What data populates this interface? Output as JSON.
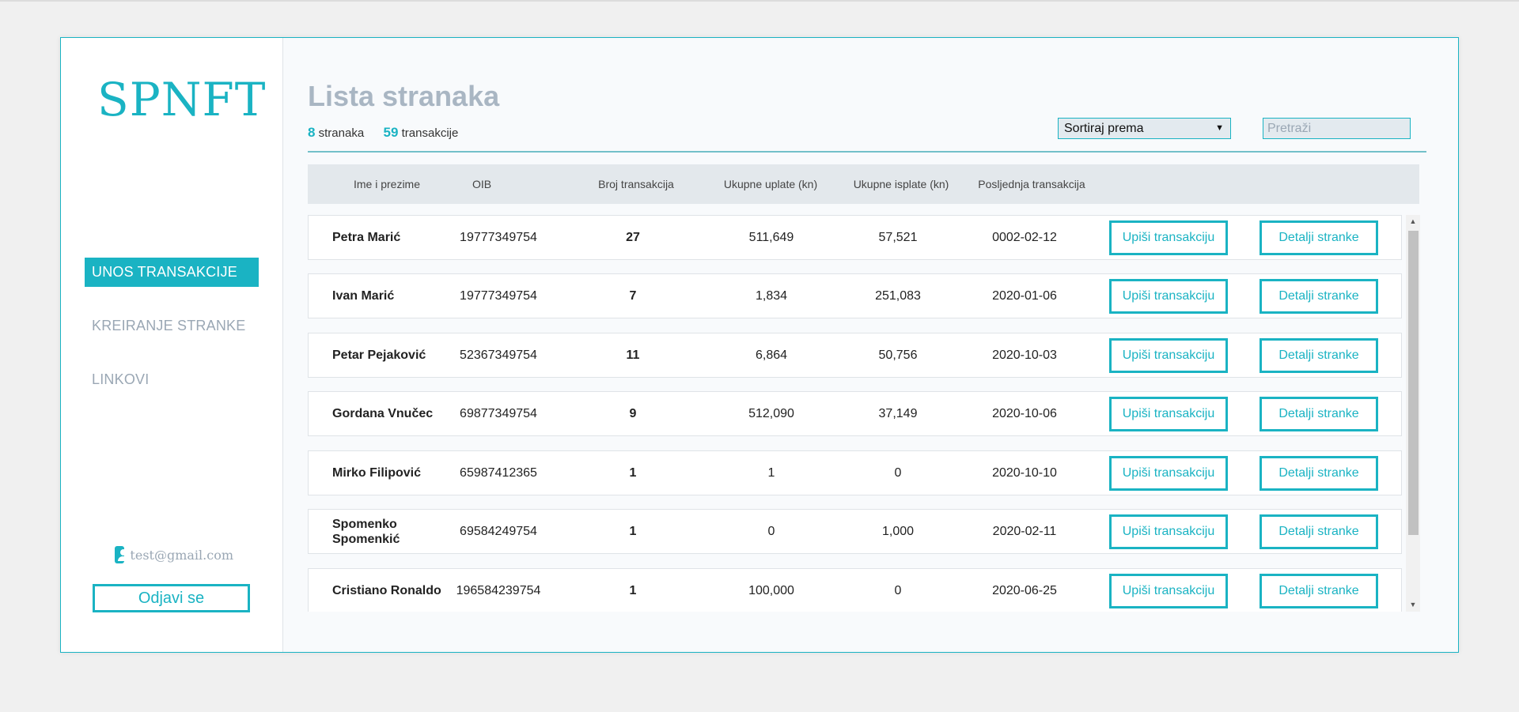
{
  "app": {
    "logo": "SPNFT"
  },
  "sidebar": {
    "nav": [
      {
        "label": "UNOS TRANSAKCIJE",
        "active": true
      },
      {
        "label": "KREIRANJE STRANKE",
        "active": false
      },
      {
        "label": "LINKOVI",
        "active": false
      }
    ],
    "user_email": "test@gmail.com",
    "logout_label": "Odjavi se"
  },
  "header": {
    "title": "Lista stranaka",
    "client_count": "8",
    "client_count_label": "stranaka",
    "transaction_count": "59",
    "transaction_count_label": "transakcije",
    "sort_label": "Sortiraj prema",
    "search_placeholder": "Pretraži"
  },
  "table": {
    "columns": [
      "Ime i prezime",
      "OIB",
      "Broj transakcija",
      "Ukupne uplate (kn)",
      "Ukupne isplate (kn)",
      "Posljednja transakcija"
    ],
    "action_add_label": "Upiši transakciju",
    "action_details_label": "Detalji stranke",
    "rows": [
      {
        "name": "Petra Marić",
        "oib": "19777349754",
        "count": "27",
        "deposits": "511,649",
        "withdrawals": "57,521",
        "last": "0002-02-12"
      },
      {
        "name": "Ivan Marić",
        "oib": "19777349754",
        "count": "7",
        "deposits": "1,834",
        "withdrawals": "251,083",
        "last": "2020-01-06"
      },
      {
        "name": "Petar Pejaković",
        "oib": "52367349754",
        "count": "11",
        "deposits": "6,864",
        "withdrawals": "50,756",
        "last": "2020-10-03"
      },
      {
        "name": "Gordana Vnučec",
        "oib": "69877349754",
        "count": "9",
        "deposits": "512,090",
        "withdrawals": "37,149",
        "last": "2020-10-06"
      },
      {
        "name": "Mirko Filipović",
        "oib": "65987412365",
        "count": "1",
        "deposits": "1",
        "withdrawals": "0",
        "last": "2020-10-10"
      },
      {
        "name": "Spomenko Spomenkić",
        "oib": "69584249754",
        "count": "1",
        "deposits": "0",
        "withdrawals": "1,000",
        "last": "2020-02-11"
      },
      {
        "name": "Cristiano Ronaldo",
        "oib": "196584239754",
        "count": "1",
        "deposits": "100,000",
        "withdrawals": "0",
        "last": "2020-06-25"
      }
    ]
  },
  "colors": {
    "accent": "#1ab3c3",
    "muted": "#9aa7b4",
    "header_bg": "#e3e8ec"
  }
}
